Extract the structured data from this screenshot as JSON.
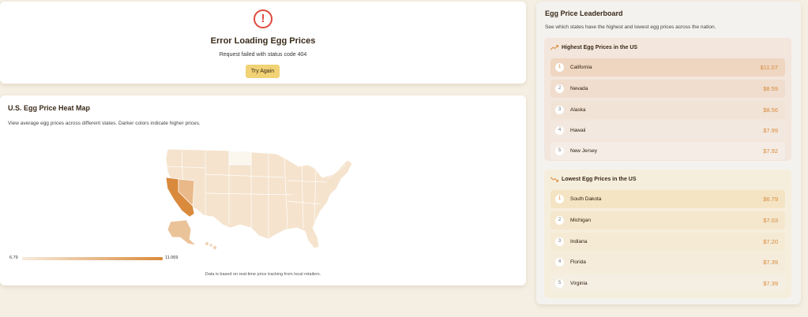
{
  "error": {
    "icon": "alert-circle-icon",
    "title": "Error Loading Egg Prices",
    "message": "Request failed with status code 404",
    "retry_label": "Try Again"
  },
  "map": {
    "title": "U.S. Egg Price Heat Map",
    "description": "View average egg prices across different states. Darker colors indicate higher prices.",
    "legend_min": "6.79",
    "legend_max": "11.069",
    "note": "Data is based on real-time price tracking from local retailers.",
    "colors": {
      "low": "#f7ebdb",
      "high": "#d98a3c"
    }
  },
  "leaderboard": {
    "title": "Egg Price Leaderboard",
    "description": "See which states have the highest and lowest egg prices across the nation.",
    "highest": {
      "heading": "Highest Egg Prices in the US",
      "icon": "trending-up-icon",
      "items": [
        {
          "rank": "1",
          "state": "California",
          "price": "$11.07"
        },
        {
          "rank": "2",
          "state": "Nevada",
          "price": "$8.59"
        },
        {
          "rank": "3",
          "state": "Alaska",
          "price": "$8.56"
        },
        {
          "rank": "4",
          "state": "Hawaii",
          "price": "$7.99"
        },
        {
          "rank": "5",
          "state": "New Jersey",
          "price": "$7.92"
        }
      ]
    },
    "lowest": {
      "heading": "Lowest Egg Prices in the US",
      "icon": "trending-down-icon",
      "items": [
        {
          "rank": "1",
          "state": "South Dakota",
          "price": "$6.79"
        },
        {
          "rank": "2",
          "state": "Michigan",
          "price": "$7.03"
        },
        {
          "rank": "3",
          "state": "Indiana",
          "price": "$7.20"
        },
        {
          "rank": "4",
          "state": "Florida",
          "price": "$7.39"
        },
        {
          "rank": "5",
          "state": "Virginia",
          "price": "$7.39"
        }
      ]
    },
    "accent_color": "#d98a3c"
  }
}
